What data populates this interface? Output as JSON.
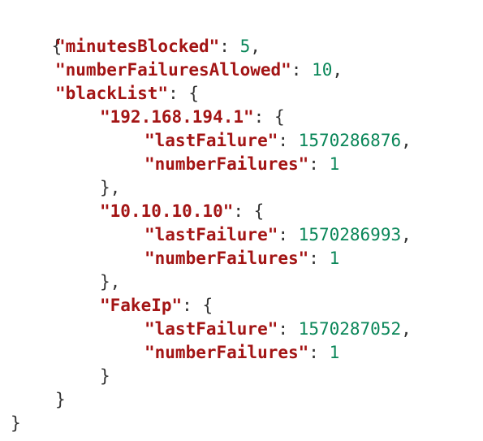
{
  "punctuation": {
    "open_brace": "{",
    "close_brace": "}",
    "close_brace_comma": "},",
    "colon": ": ",
    "comma": ",",
    "open_after_colon": ": {"
  },
  "root": {
    "minutesBlocked": {
      "key": "\"minutesBlocked\"",
      "value": "5"
    },
    "numberFailuresAllowed": {
      "key": "\"numberFailuresAllowed\"",
      "value": "10"
    },
    "blackList": {
      "key": "\"blackList\"",
      "entries": [
        {
          "key": "\"192.168.194.1\"",
          "lastFailure": {
            "key": "\"lastFailure\"",
            "value": "1570286876"
          },
          "numberFailures": {
            "key": "\"numberFailures\"",
            "value": "1"
          }
        },
        {
          "key": "\"10.10.10.10\"",
          "lastFailure": {
            "key": "\"lastFailure\"",
            "value": "1570286993"
          },
          "numberFailures": {
            "key": "\"numberFailures\"",
            "value": "1"
          }
        },
        {
          "key": "\"FakeIp\"",
          "lastFailure": {
            "key": "\"lastFailure\"",
            "value": "1570287052"
          },
          "numberFailures": {
            "key": "\"numberFailures\"",
            "value": "1"
          }
        }
      ]
    }
  },
  "colors": {
    "key": "#a31515",
    "number": "#098658",
    "punctuation": "#333333",
    "background": "#ffffff"
  }
}
